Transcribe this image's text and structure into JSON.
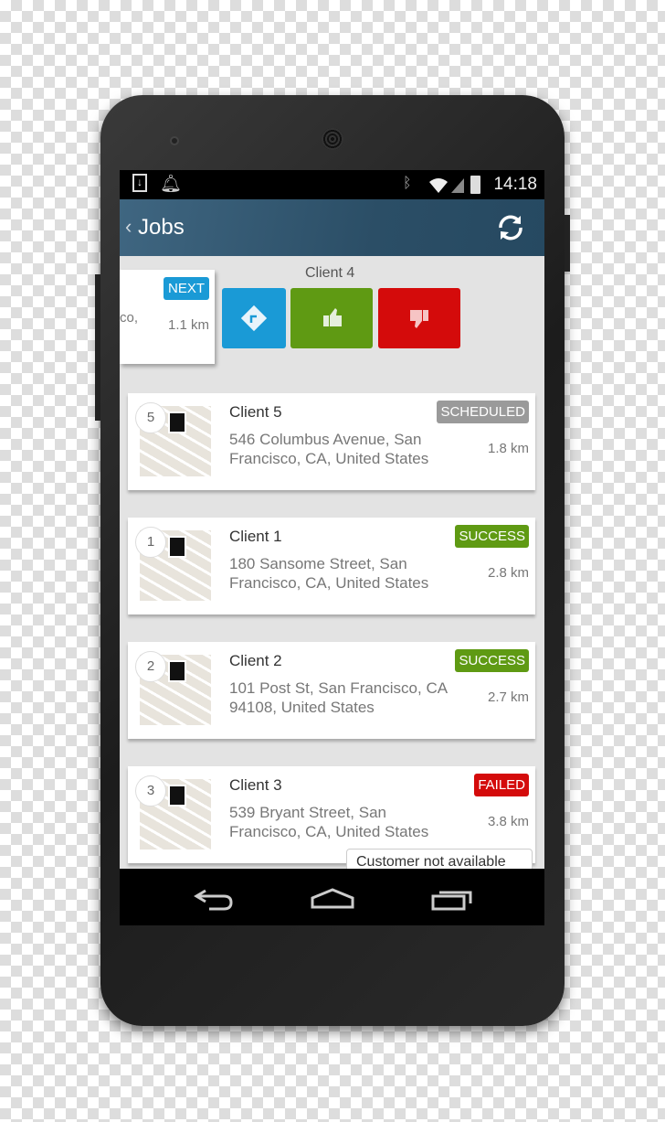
{
  "status_bar": {
    "time": "14:18",
    "icons": [
      "download-icon",
      "bell-icon",
      "bluetooth-icon",
      "wifi-icon",
      "signal-icon",
      "battery-icon"
    ]
  },
  "app_bar": {
    "title": "Jobs",
    "back_icon": "chevron-left-icon",
    "refresh_icon": "refresh-icon"
  },
  "active_job": {
    "name": "Client 4",
    "badge": "NEXT",
    "address_fragment": "co,",
    "distance": "1.1 km",
    "actions": [
      {
        "icon": "directions-icon",
        "color": "#1a9ad6"
      },
      {
        "icon": "thumbs-up-icon",
        "color": "#5f9a13"
      },
      {
        "icon": "thumbs-down-icon",
        "color": "#d40b0b"
      }
    ]
  },
  "jobs": [
    {
      "order": "5",
      "name": "Client 5",
      "address": "546 Columbus Avenue, San Francisco, CA, United States",
      "status": "SCHEDULED",
      "status_color": "#9a9a9a",
      "distance": "1.8 km"
    },
    {
      "order": "1",
      "name": "Client 1",
      "address": "180 Sansome Street, San Francisco, CA, United States",
      "status": "SUCCESS",
      "status_color": "#5f9a13",
      "distance": "2.8 km"
    },
    {
      "order": "2",
      "name": "Client 2",
      "address": "101 Post St, San Francisco, CA 94108, United States",
      "status": "SUCCESS",
      "status_color": "#5f9a13",
      "distance": "2.7 km"
    },
    {
      "order": "3",
      "name": "Client 3",
      "address": "539 Bryant Street, San Francisco, CA, United States",
      "status": "FAILED",
      "status_color": "#d40b0b",
      "distance": "3.8 km",
      "note": "Customer not available"
    }
  ]
}
